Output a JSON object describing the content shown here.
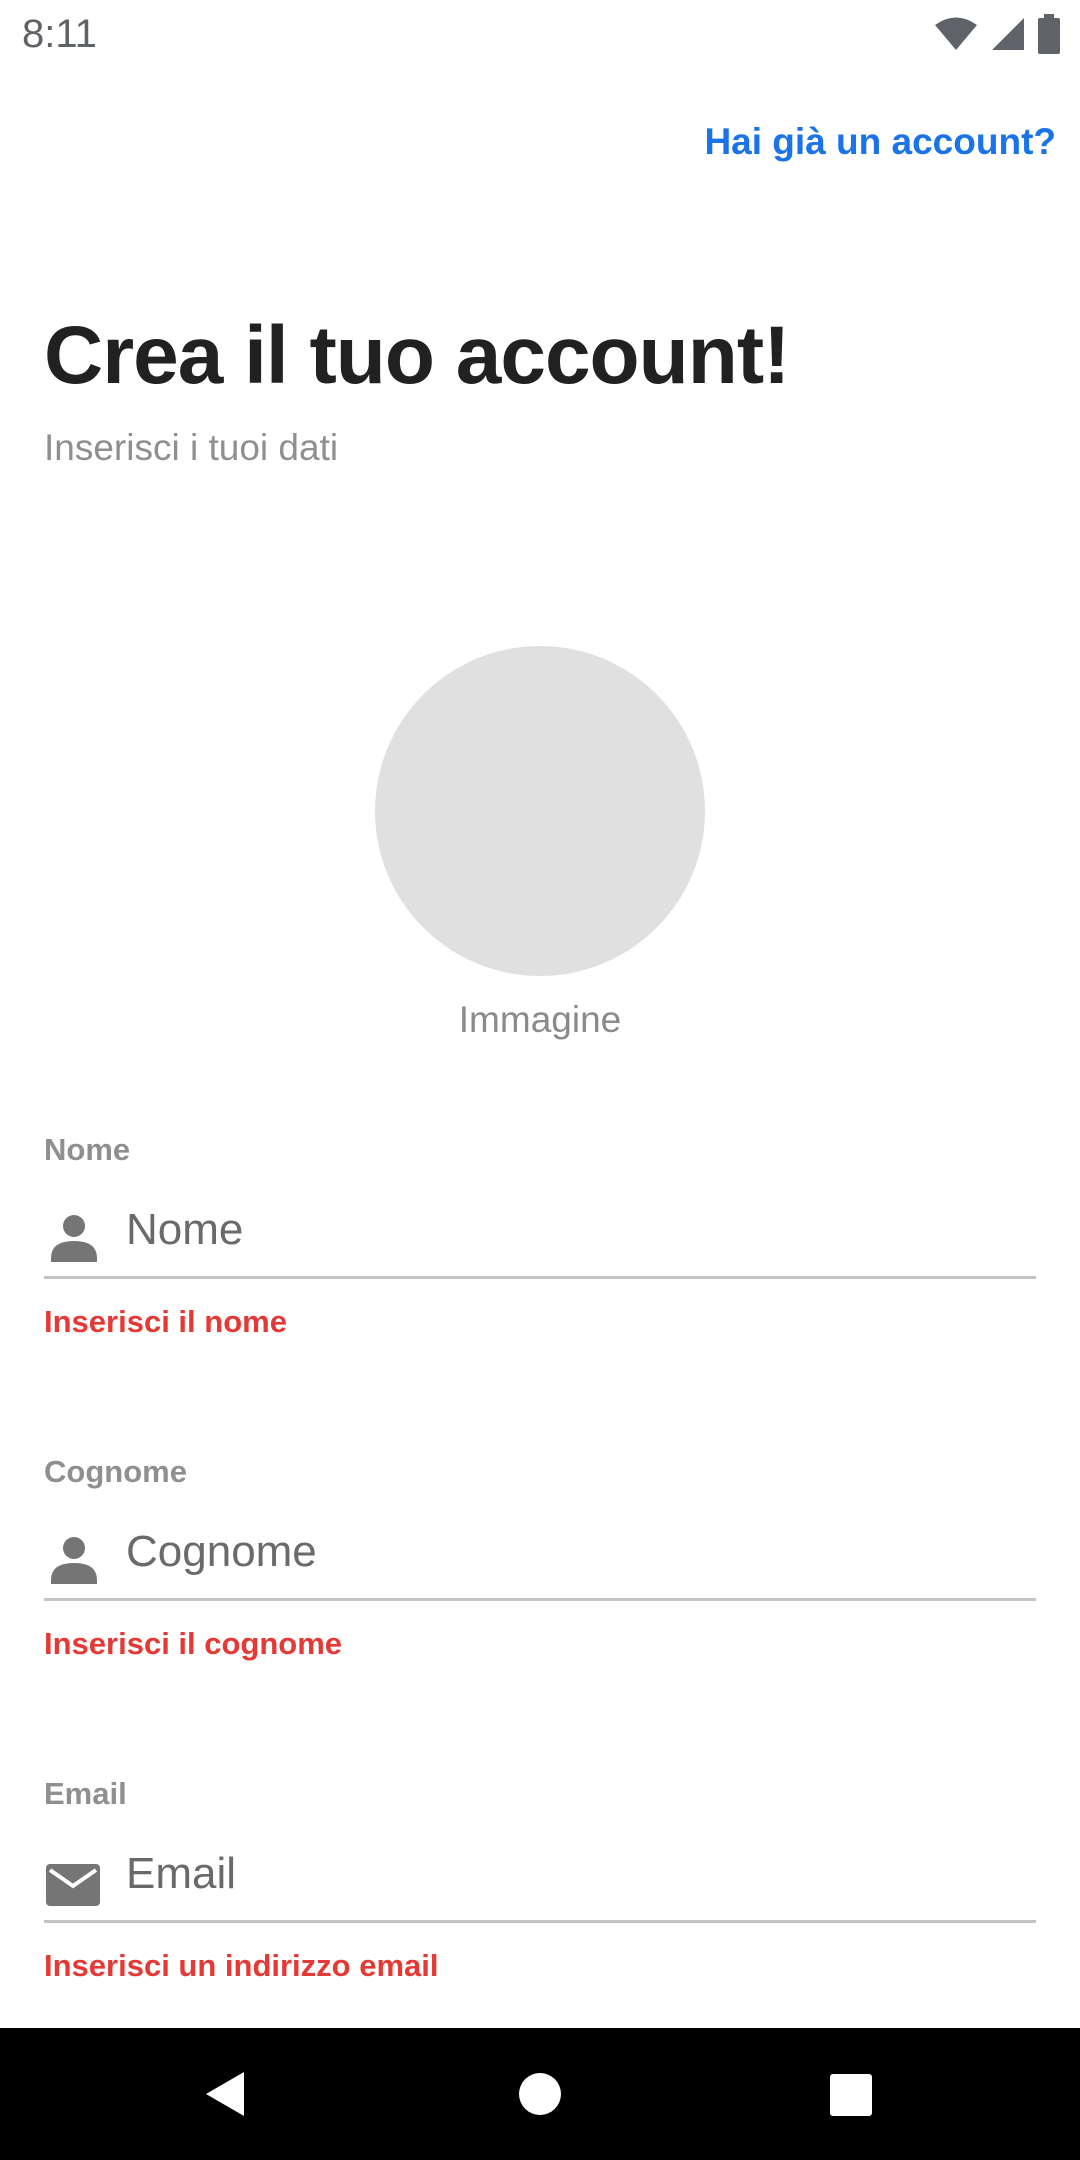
{
  "status_bar": {
    "time": "8:11",
    "icons": [
      "wifi-icon",
      "signal-icon",
      "battery-icon"
    ]
  },
  "header": {
    "login_link": "Hai già un account?"
  },
  "main": {
    "title": "Crea il tuo account!",
    "subtitle": "Inserisci i tuoi dati",
    "avatar_label": "Immagine"
  },
  "form": {
    "fields": [
      {
        "label": "Nome",
        "placeholder": "Nome",
        "value": "",
        "icon": "person-icon",
        "error": "Inserisci il nome"
      },
      {
        "label": "Cognome",
        "placeholder": "Cognome",
        "value": "",
        "icon": "person-icon",
        "error": "Inserisci il cognome"
      },
      {
        "label": "Email",
        "placeholder": "Email",
        "value": "",
        "icon": "mail-icon",
        "error": "Inserisci un indirizzo email"
      }
    ]
  },
  "nav_bar": {
    "buttons": [
      "back-icon",
      "home-icon",
      "recents-icon"
    ]
  },
  "colors": {
    "accent": "#1a73e8",
    "title": "#212121",
    "secondary_text": "#8f8f8f",
    "error": "#e53935",
    "avatar_placeholder": "#e0e0e0",
    "divider": "#c4c4c4"
  }
}
